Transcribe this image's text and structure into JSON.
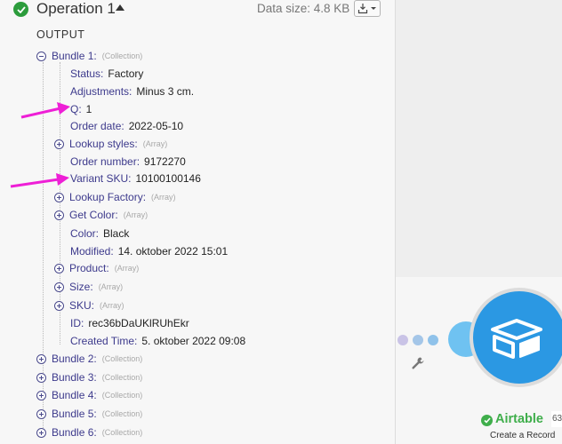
{
  "operation": {
    "title": "Operation 1",
    "data_size": "Data size: 4.8 KB",
    "output_label": "OUTPUT"
  },
  "bundle1": {
    "label": "Bundle 1:",
    "type": "(Collection)",
    "fields": [
      {
        "key": "Status:",
        "value": "Factory"
      },
      {
        "key": "Adjustments:",
        "value": "Minus 3 cm."
      },
      {
        "key": "Q:",
        "value": "1"
      },
      {
        "key": "Order date:",
        "value": "2022-05-10"
      },
      {
        "key": "Lookup styles:",
        "type": "(Array)"
      },
      {
        "key": "Order number:",
        "value": "9172270"
      },
      {
        "key": "Variant SKU:",
        "value": "10100100146"
      },
      {
        "key": "Lookup Factory:",
        "type": "(Array)"
      },
      {
        "key": "Get Color:",
        "type": "(Array)"
      },
      {
        "key": "Color:",
        "value": "Black"
      },
      {
        "key": "Modified:",
        "value": "14. oktober 2022 15:01"
      },
      {
        "key": "Product:",
        "type": "(Array)"
      },
      {
        "key": "Size:",
        "type": "(Array)"
      },
      {
        "key": "SKU:",
        "type": "(Array)"
      },
      {
        "key": "ID:",
        "value": "rec36bDaUKlRUhEkr"
      },
      {
        "key": "Created Time:",
        "value": "5. oktober 2022 09:08"
      }
    ]
  },
  "collapsed_bundles": [
    {
      "label": "Bundle 2:",
      "type": "(Collection)"
    },
    {
      "label": "Bundle 3:",
      "type": "(Collection)"
    },
    {
      "label": "Bundle 4:",
      "type": "(Collection)"
    },
    {
      "label": "Bundle 5:",
      "type": "(Collection)"
    },
    {
      "label": "Bundle 6:",
      "type": "(Collection)"
    }
  ],
  "module": {
    "name": "Airtable",
    "badge": "63",
    "subtitle": "Create a Record"
  },
  "colors": {
    "success": "#2c9c3c",
    "key_text": "#3d3a8c",
    "annotation_arrow": "#ee1fd6",
    "airtable_blue": "#2b98e3",
    "airtable_green": "#3fae4b"
  },
  "icons": [
    "check-circle-icon",
    "caret-up-icon",
    "download-icon",
    "chevron-down-icon",
    "collapse-icon",
    "expand-icon",
    "arrow-annotation",
    "wrench-icon",
    "airtable-logo-icon"
  ]
}
